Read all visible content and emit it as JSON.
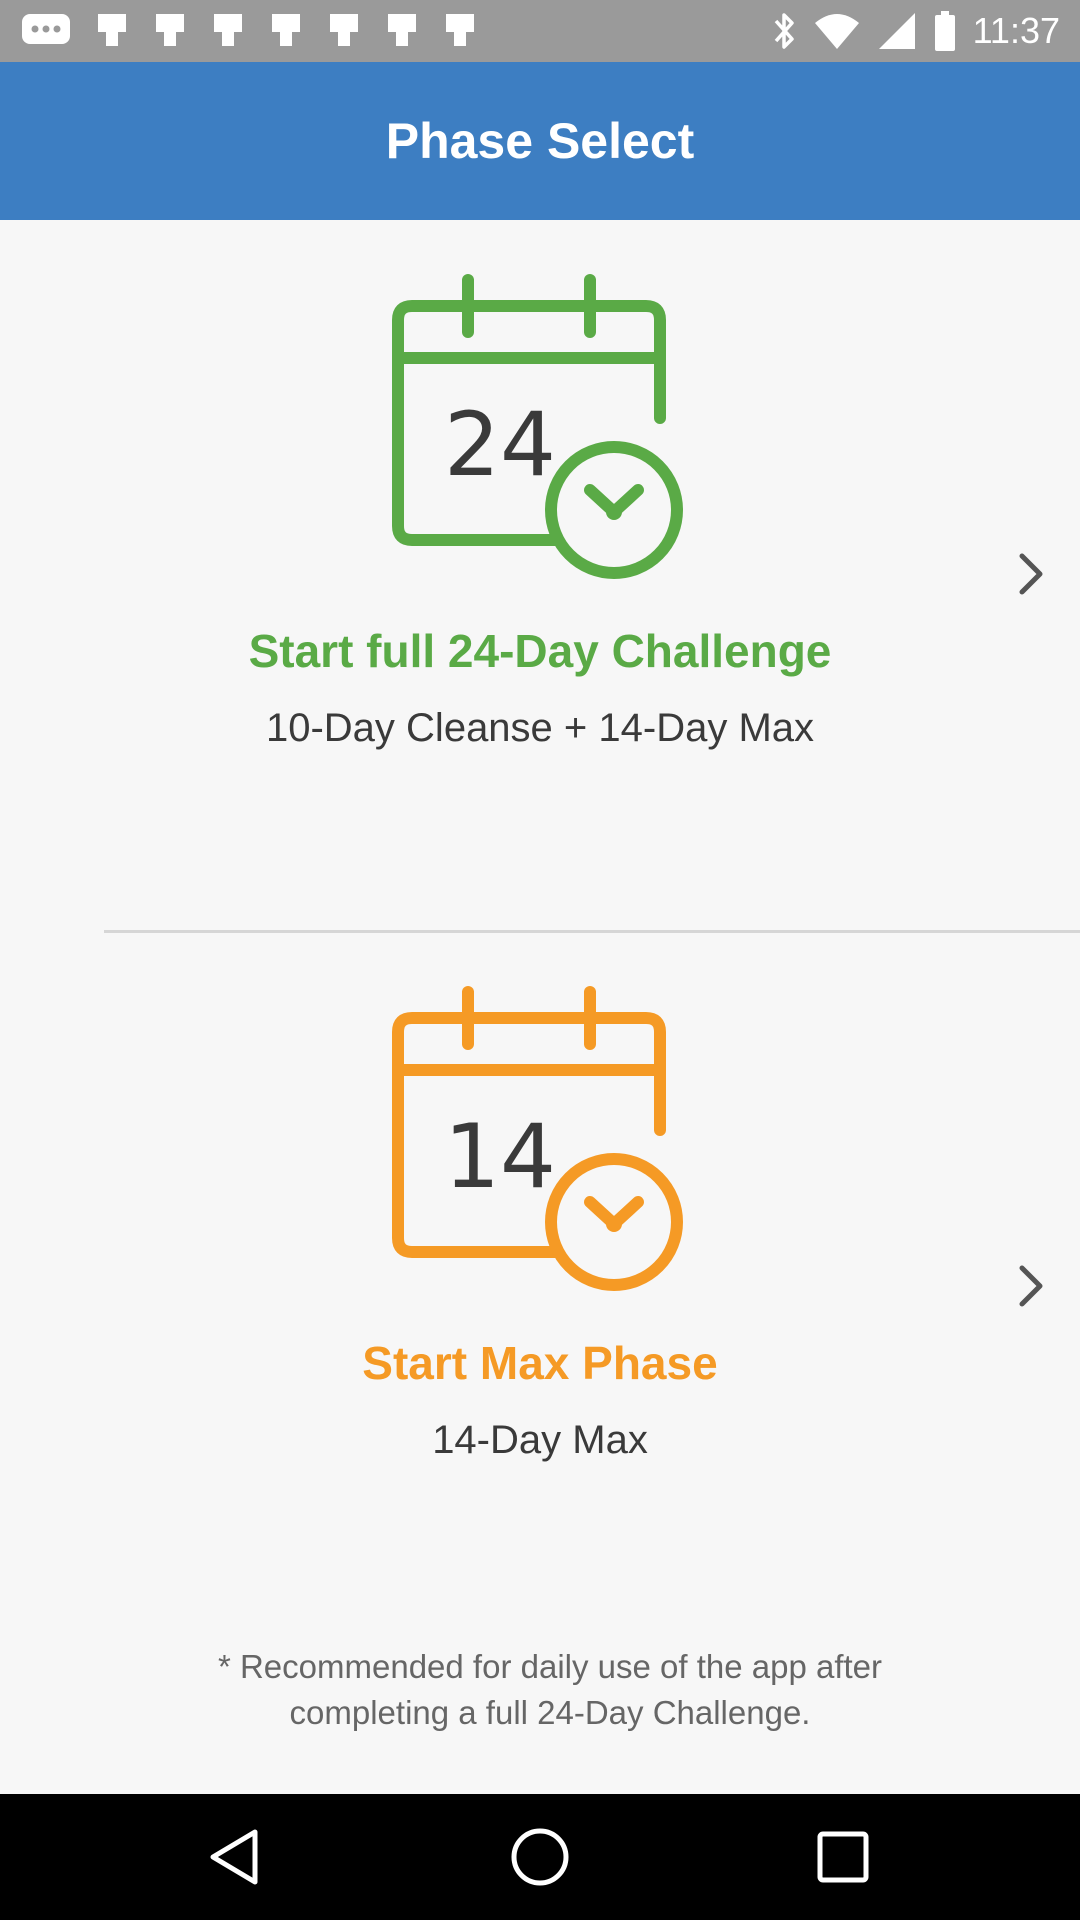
{
  "status_bar": {
    "time": "11:37",
    "left_icons": [
      "messages-icon",
      "app-notification-icon",
      "app-notification-icon",
      "app-notification-icon",
      "app-notification-icon",
      "app-notification-icon",
      "app-notification-icon",
      "app-notification-icon"
    ],
    "right_icons": [
      "bluetooth-icon",
      "wifi-icon",
      "cellular-signal-icon",
      "battery-icon"
    ]
  },
  "header": {
    "title": "Phase Select"
  },
  "options": [
    {
      "icon": "calendar-clock-icon",
      "number": "24",
      "title": "Start full 24-Day Challenge",
      "subtitle": "10-Day Cleanse + 14-Day Max",
      "color": "#5aaa46"
    },
    {
      "icon": "calendar-clock-icon",
      "number": "14",
      "title": "Start Max Phase",
      "subtitle": "14-Day Max",
      "color": "#f59a25"
    }
  ],
  "footnote": "* Recommended for daily use of the app after completing a full 24-Day Challenge.",
  "nav": {
    "icons": [
      "back-icon",
      "home-icon",
      "recents-icon"
    ]
  },
  "colors": {
    "header": "#3d7ec2",
    "background": "#f7f7f7",
    "status_bar": "#9a9a9a",
    "nav_bar": "#000000"
  }
}
